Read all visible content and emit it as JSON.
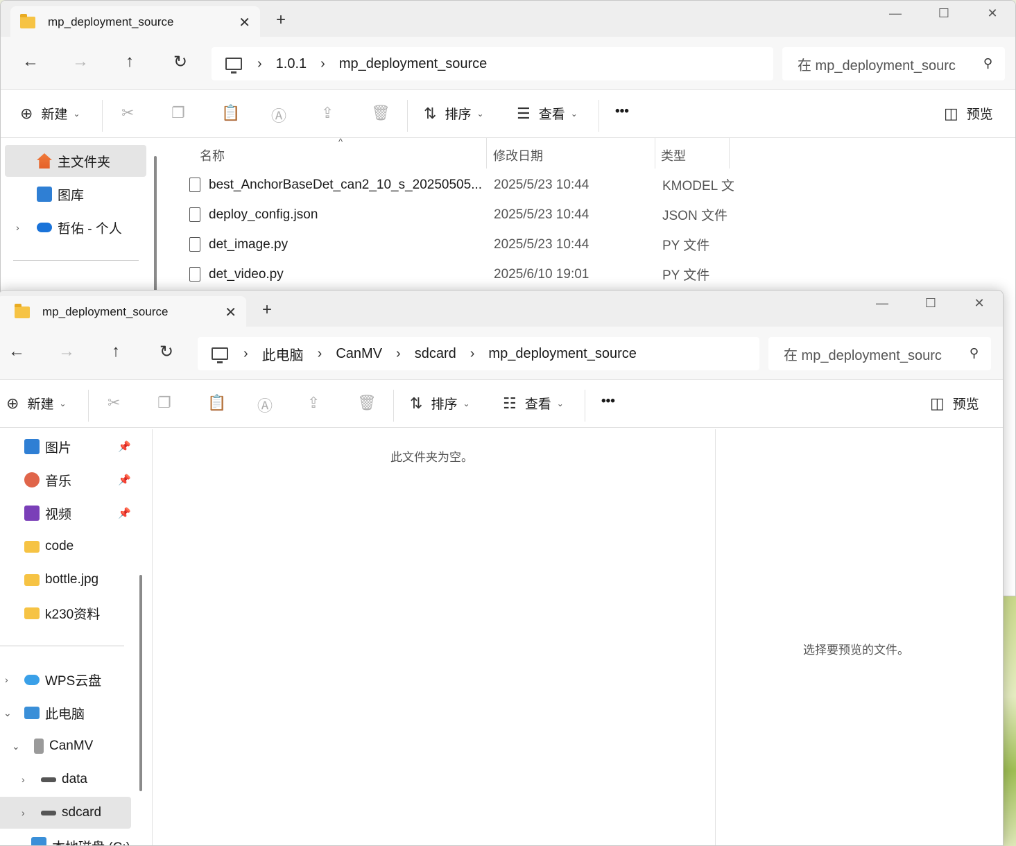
{
  "back_window": {
    "tab_title": "mp_deployment_source",
    "breadcrumb": [
      "1.0.1",
      "mp_deployment_source"
    ],
    "search_placeholder": "在 mp_deployment_sourc",
    "toolbar": {
      "new": "新建",
      "sort": "排序",
      "view": "查看",
      "more": "•••",
      "preview": "预览"
    },
    "sidebar": [
      {
        "label": "主文件夹",
        "icon": "home-icon"
      },
      {
        "label": "图库",
        "icon": "gallery-icon"
      },
      {
        "label": "哲佑 - 个人",
        "icon": "onedrive-icon"
      }
    ],
    "columns": {
      "name": "名称",
      "date": "修改日期",
      "type": "类型"
    },
    "files": [
      {
        "name": "best_AnchorBaseDet_can2_10_s_20250505...",
        "date": "2025/5/23 10:44",
        "type": "KMODEL 文"
      },
      {
        "name": "deploy_config.json",
        "date": "2025/5/23 10:44",
        "type": "JSON 文件"
      },
      {
        "name": "det_image.py",
        "date": "2025/5/23 10:44",
        "type": "PY 文件"
      },
      {
        "name": "det_video.py",
        "date": "2025/6/10 19:01",
        "type": "PY 文件"
      }
    ]
  },
  "front_window": {
    "tab_title": "mp_deployment_source",
    "breadcrumb": [
      "此电脑",
      "CanMV",
      "sdcard",
      "mp_deployment_source"
    ],
    "search_placeholder": "在 mp_deployment_sourc",
    "toolbar": {
      "new": "新建",
      "sort": "排序",
      "view": "查看",
      "more": "•••",
      "preview": "预览"
    },
    "sidebar": [
      {
        "label": "图片",
        "icon": "pictures-icon",
        "pinned": true
      },
      {
        "label": "音乐",
        "icon": "music-icon",
        "pinned": true
      },
      {
        "label": "视频",
        "icon": "videos-icon",
        "pinned": true
      },
      {
        "label": "code",
        "icon": "folder-icon"
      },
      {
        "label": "bottle.jpg",
        "icon": "folder-icon"
      },
      {
        "label": "k230资料",
        "icon": "folder-icon"
      },
      {
        "label": "WPS云盘",
        "icon": "cloud-icon"
      },
      {
        "label": "此电脑",
        "icon": "computer-icon"
      },
      {
        "label": "CanMV",
        "icon": "device-icon"
      },
      {
        "label": "data",
        "icon": "drive-icon"
      },
      {
        "label": "sdcard",
        "icon": "drive-icon"
      },
      {
        "label": "本地磁盘 (C:)",
        "icon": "drive-icon"
      }
    ],
    "empty_message": "此文件夹为空。",
    "preview_message": "选择要预览的文件。"
  },
  "colors": {
    "folder": "#f6c344",
    "selected": "#e5e5e5",
    "tabbar": "#eeeeee"
  }
}
